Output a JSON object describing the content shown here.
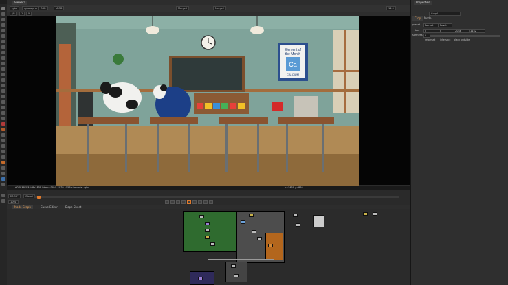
{
  "viewer": {
    "tab_label": "Viewer1",
    "channels": "rgba",
    "alpha": "rgba.alpha",
    "colorspace": "RGB",
    "input_a": "A",
    "input_b": "B",
    "frame_size": "sRGB",
    "zoom": "1",
    "gain": "f/8",
    "gamma": "Y",
    "node_a": "Merge5",
    "node_b": "Merge2",
    "frame_readout": "14.9",
    "info_left": "ARRI 16:9 2048x1152  bbox: -30 -2 2078 1156 channels: rgba",
    "info_right": "x=1457 y=880"
  },
  "timeline": {
    "fps": "23.98*",
    "mode": "Global",
    "frame": "1001"
  },
  "bottom_tabs": [
    {
      "label": "Node Graph"
    },
    {
      "label": "Curve Editor"
    },
    {
      "label": "Dope Sheet"
    }
  ],
  "properties": {
    "panel_label": "Properties",
    "node_name": "Crop1",
    "tab_crop": "Crop",
    "tab_node": "Node",
    "preset_label": "preset",
    "preset_value": "Format",
    "preset_button": "Reset",
    "box_label": "box",
    "box_x": "0",
    "box_y": "0",
    "box_r": "2048",
    "box_t": "1152",
    "softness_label": "softness",
    "softness_value": "0",
    "reformat_label": "reformat",
    "intersect_label": "intersect",
    "black_outside_label": "black outside"
  },
  "image": {
    "poster_line1": "Element of",
    "poster_line2": "the Month",
    "poster_symbol": "Ca",
    "poster_name": "CALCIUM"
  }
}
